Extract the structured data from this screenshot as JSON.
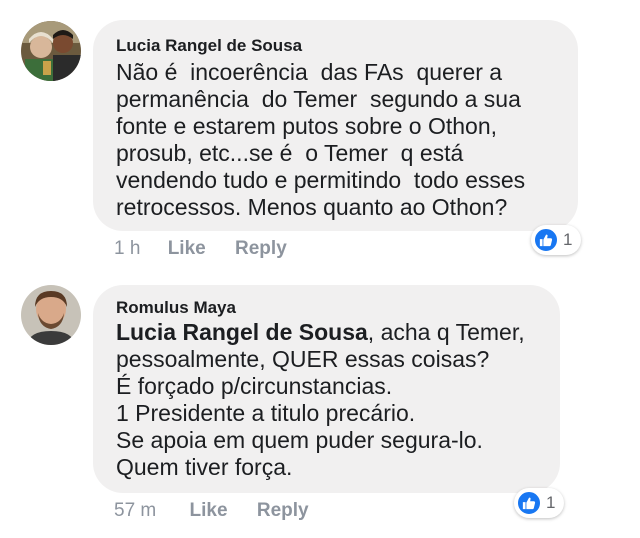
{
  "comments": [
    {
      "author": "Lucia Rangel de Sousa",
      "lines": [
        "Não é  incoerência  das FAs  querer a",
        "permanência  do Temer  segundo a sua",
        "fonte e estarem putos sobre o Othon,",
        "prosub, etc...se é  o Temer  q está",
        "vendendo tudo e permitindo  todo esses",
        "retrocessos. Menos quanto ao Othon?"
      ],
      "time": "1 h",
      "like_label": "Like",
      "reply_label": "Reply",
      "reaction_icon": "thumbs-up-icon",
      "reaction_count": "1"
    },
    {
      "author": "Romulus Maya",
      "mention": "Lucia Rangel de Sousa",
      "first_line_rest": ", acha q Temer,",
      "lines": [
        "pessoalmente, QUER essas coisas?",
        "É forçado p/circunstancias.",
        "1 Presidente a titulo precário.",
        "Se apoia em quem puder segura-lo.",
        "Quem tiver força."
      ],
      "time": "57 m",
      "like_label": "Like",
      "reply_label": "Reply",
      "reaction_icon": "thumbs-up-icon",
      "reaction_count": "1"
    }
  ],
  "colors": {
    "bubble": "#f1f0f0",
    "text": "#1c1e21",
    "meta": "#8d949e",
    "like_blue": "#1877f2"
  }
}
